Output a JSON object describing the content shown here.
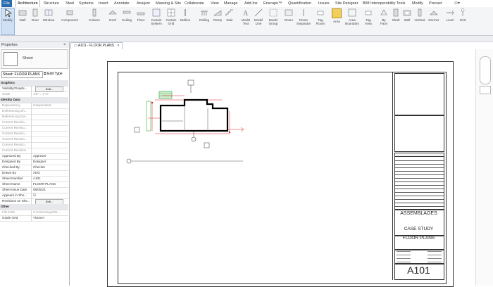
{
  "menu": {
    "tabs": [
      "File",
      "Architecture",
      "Structure",
      "Steel",
      "Systems",
      "Insert",
      "Annotate",
      "Analyze",
      "Massing & Site",
      "Collaborate",
      "View",
      "Manage",
      "Add-Ins",
      "Enscape™",
      "Quantification",
      "Issues",
      "Site Designer",
      "BIM Interoperability Tools",
      "Modify",
      "Precast"
    ]
  },
  "ribbon": {
    "tools": [
      "Modify",
      "Wall",
      "Door",
      "Window",
      "Component",
      "Column",
      "Roof",
      "Ceiling",
      "Floor",
      "Curtain System",
      "Curtain Grid",
      "Mullion",
      "Railing",
      "Ramp",
      "Stair",
      "Model Text",
      "Model Line",
      "Model Group",
      "Room",
      "Room Separator",
      "Tag Room",
      "Area",
      "Area Boundary",
      "Tag Area",
      "By Face",
      "Shaft",
      "Wall",
      "Vertical",
      "Dormer",
      "Level",
      "Grid"
    ]
  },
  "view_tab": {
    "label": "A101 - FLOOR PLANS",
    "close": "×"
  },
  "properties": {
    "title": "Properties",
    "type_name": "Sheet",
    "type_selector": "Sheet: FLOOR PLANS",
    "edit_type": "Edit Type",
    "rows": [
      {
        "k": "Graphics",
        "v": "",
        "section": true
      },
      {
        "k": "Visibility/Graphi...",
        "v": "Edit...",
        "button": true
      },
      {
        "k": "Scale",
        "v": "1/8\" = 1'-0\"",
        "grey": true
      },
      {
        "k": "Identity Data",
        "v": "",
        "section": true
      },
      {
        "k": "Dependency",
        "v": "Independent",
        "grey": true
      },
      {
        "k": "Referencing Sh...",
        "v": "",
        "grey": true
      },
      {
        "k": "Referencing Det...",
        "v": "",
        "grey": true
      },
      {
        "k": "Current Revisio...",
        "v": "",
        "grey": true
      },
      {
        "k": "Current Revisio...",
        "v": "",
        "grey": true
      },
      {
        "k": "Current Revisio...",
        "v": "",
        "grey": true
      },
      {
        "k": "Current Revisio...",
        "v": "",
        "grey": true
      },
      {
        "k": "Current Revisio...",
        "v": "",
        "grey": true
      },
      {
        "k": "Current Revision",
        "v": "",
        "grey": true
      },
      {
        "k": "Approved By",
        "v": "Approver"
      },
      {
        "k": "Designed By",
        "v": "Designer"
      },
      {
        "k": "Checked By",
        "v": "Checker"
      },
      {
        "k": "Drawn By",
        "v": "ADG"
      },
      {
        "k": "Sheet Number",
        "v": "A101"
      },
      {
        "k": "Sheet Name",
        "v": "FLOOR PLANS"
      },
      {
        "k": "Sheet Issue Date",
        "v": "06/05/21"
      },
      {
        "k": "Appears in She...",
        "v": "☑"
      },
      {
        "k": "Revisions on She...",
        "v": "Edit...",
        "button": true
      },
      {
        "k": "Other",
        "v": "",
        "section": true
      },
      {
        "k": "File Path",
        "v": "C:\\Users\\arg\\201...",
        "grey": true
      },
      {
        "k": "Guide Grid",
        "v": "<None>"
      }
    ]
  },
  "titleblock": {
    "line1": "ASSEMBLAGES",
    "line2": "CASE STUDY",
    "line3": "FLOOR PLANS",
    "sheet_number": "A101"
  },
  "colors": {
    "accent": "#2b6cb0",
    "dimension_red": "#e0242b",
    "tag_green": "#3fae3f"
  }
}
